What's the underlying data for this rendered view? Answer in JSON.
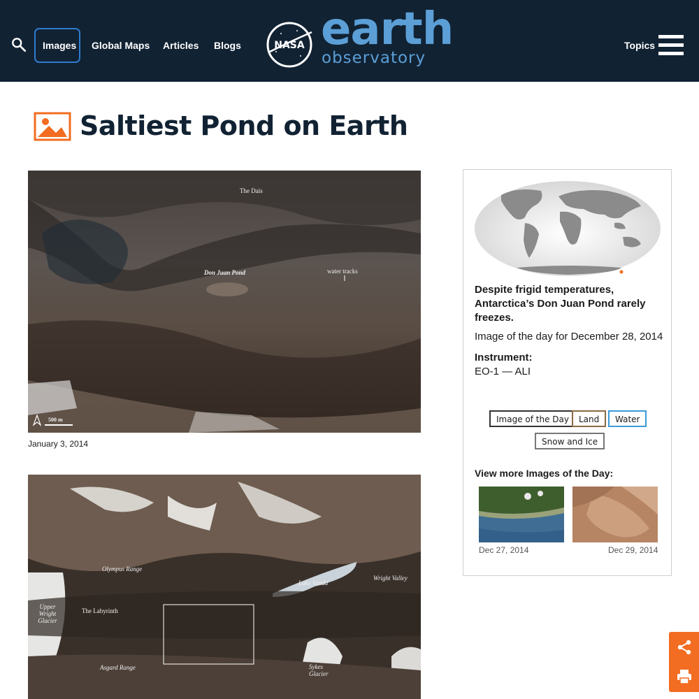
{
  "nav": {
    "links": [
      "Images",
      "Global Maps",
      "Articles",
      "Blogs"
    ],
    "topics": "Topics",
    "logo_line1": "earth",
    "logo_line2": "observatory",
    "logo_badge": "NASA"
  },
  "page": {
    "title": "Saltiest Pond on Earth"
  },
  "image1": {
    "labels": [
      "The Dais",
      "Don Juan Pond",
      "water tracks",
      "500 m"
    ],
    "caption": "January 3, 2014"
  },
  "image2": {
    "labels": [
      "Olympus Range",
      "Lake Vanda",
      "Wright Valley",
      "Upper Wright Glacier",
      "The Labyrinth",
      "Asgard Range",
      "Sykes Glacier"
    ]
  },
  "sidebar": {
    "description": "Despite frigid temperatures, Antarctica’s Don Juan Pond rarely freezes.",
    "image_of_day": "Image of the day for December 28, 2014",
    "instrument_heading": "Instrument:",
    "instrument_value": "EO-1 — ALI",
    "tags": [
      "Image of the Day",
      "Land",
      "Water",
      "Snow and Ice"
    ],
    "more_heading": "View more Images of the Day:",
    "thumbs": [
      {
        "date": "Dec 27, 2014"
      },
      {
        "date": "Dec 29, 2014"
      }
    ]
  },
  "colors": {
    "nav_bg": "#112233",
    "accent_orange": "#f26c21",
    "accent_blue": "#2e7bcf",
    "tag_land": "#8a6a45",
    "tag_water": "#3b9ad9"
  },
  "icons": [
    "search-icon",
    "menu-icon",
    "image-icon",
    "share-icon",
    "print-icon",
    "north-arrow-icon"
  ]
}
